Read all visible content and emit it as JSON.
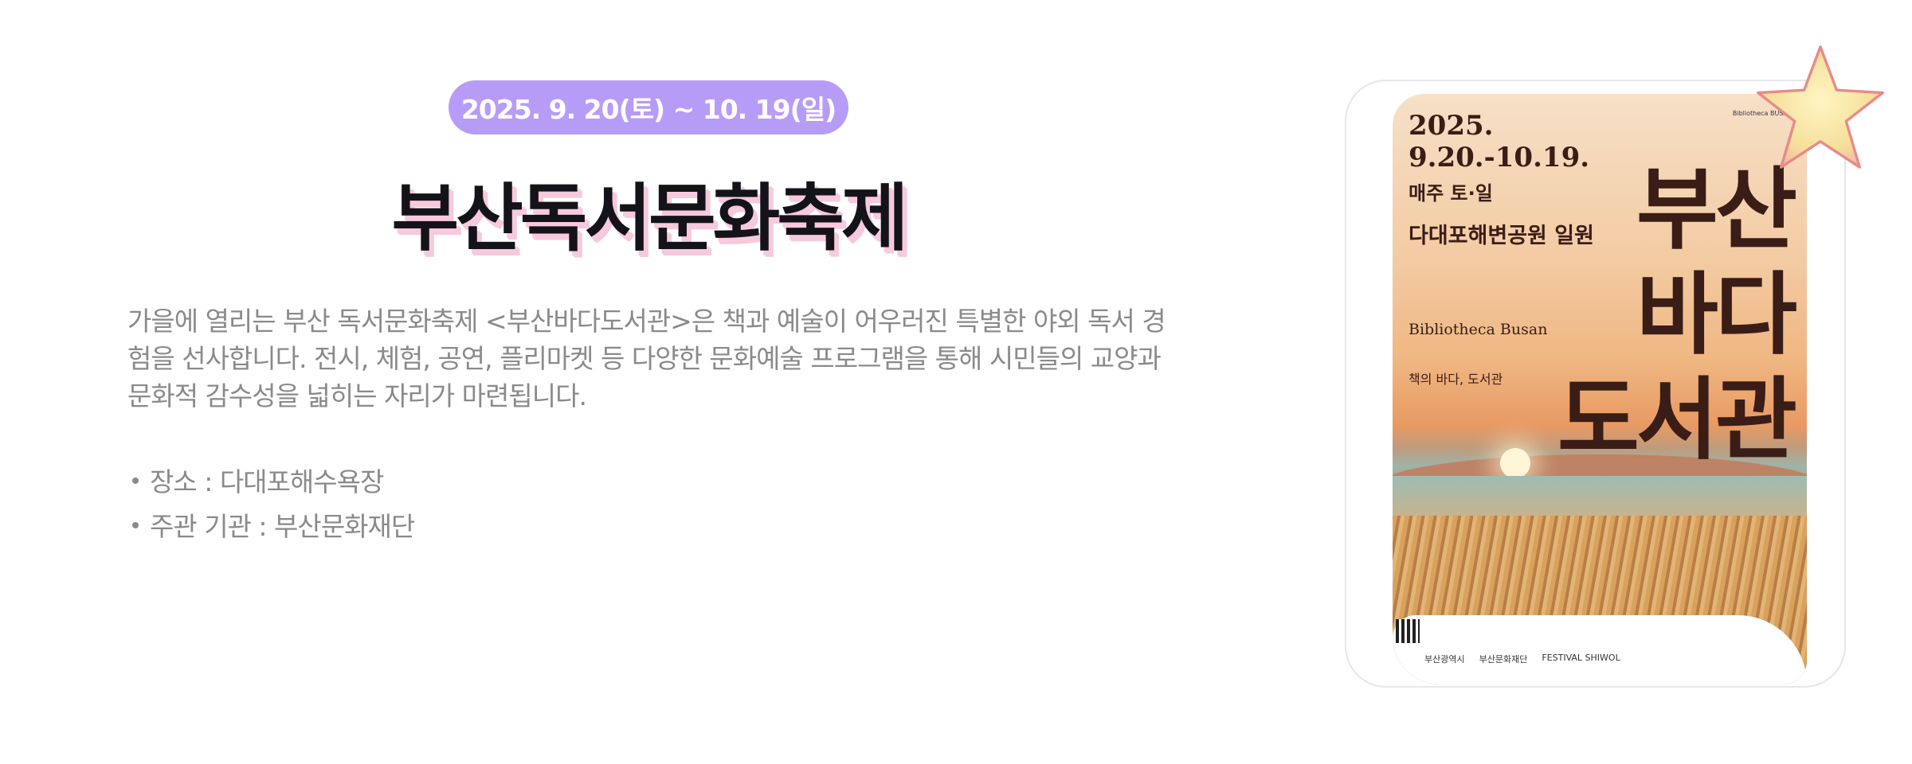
{
  "event": {
    "date_range": "2025. 9. 20(토) ~ 10. 19(일)",
    "title": "부산독서문화축제",
    "description": "가을에 열리는 부산 독서문화축제 <부산바다도서관>은 책과 예술이 어우러진 특별한 야외 독서 경험을 선사합니다. 전시, 체험, 공연, 플리마켓 등 다양한 문화예술 프로그램을 통해 시민들의 교양과 문화적 감수성을 넓히는 자리가 마련됩니다.",
    "info": [
      {
        "text": "장소 : 다대포해수욕장"
      },
      {
        "text": "주관 기관 : 부산문화재단"
      }
    ]
  },
  "poster": {
    "year_line1": "2025.",
    "year_line2": "9.20.-10.19.",
    "weekday": "매주 토·일",
    "venue": "다대포해변공원 일원",
    "latin": "Bibliotheca Busan",
    "tagline": "책의 바다, 도서관",
    "big_line1": "부산",
    "big_line2": "바다",
    "big_line3": "도서관",
    "corner_logo": "Bibliotheca BUSAN",
    "logos": [
      "부산광역시",
      "부산문화재단",
      "FESTIVAL SHIWOL"
    ]
  },
  "colors": {
    "pill": "#b79cf7",
    "title_shadow": "#f6c9dc",
    "body_text": "#8a8a8a",
    "star": "#f5df9a"
  }
}
